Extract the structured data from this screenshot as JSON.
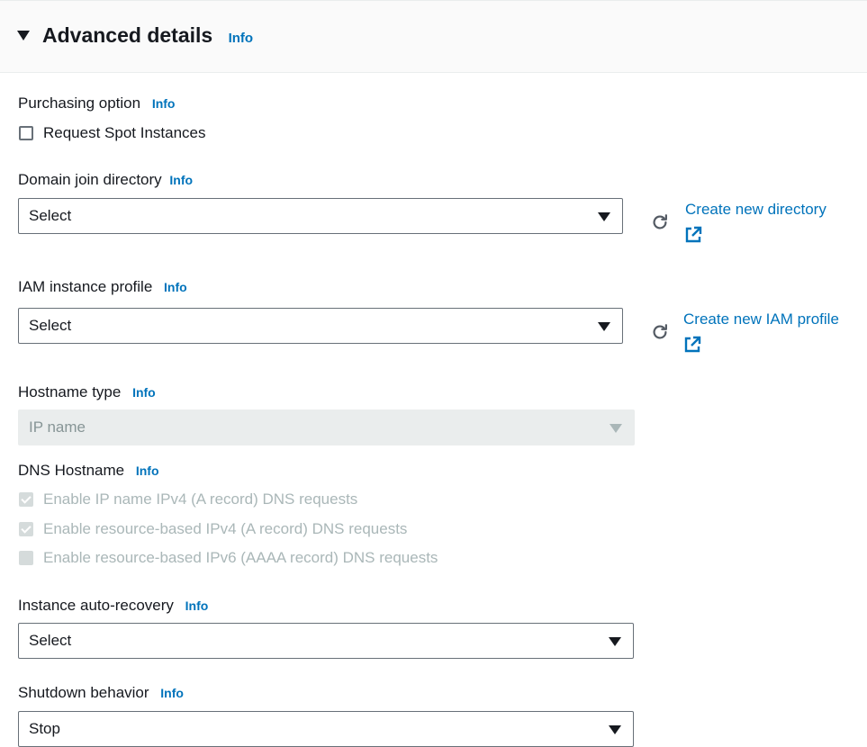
{
  "header": {
    "title": "Advanced details",
    "info": "Info"
  },
  "purchasing": {
    "label": "Purchasing option",
    "info": "Info",
    "checkbox_label": "Request Spot Instances"
  },
  "domain_join": {
    "label": "Domain join directory",
    "info": "Info",
    "value": "Select",
    "link": "Create new directory"
  },
  "iam_profile": {
    "label": "IAM instance profile",
    "info": "Info",
    "value": "Select",
    "link": "Create new IAM profile"
  },
  "hostname_type": {
    "label": "Hostname type",
    "info": "Info",
    "value": "IP name"
  },
  "dns_hostname": {
    "label": "DNS Hostname",
    "info": "Info",
    "options": [
      {
        "label": "Enable IP name IPv4 (A record) DNS requests",
        "checked": true
      },
      {
        "label": "Enable resource-based IPv4 (A record) DNS requests",
        "checked": true
      },
      {
        "label": "Enable resource-based IPv6 (AAAA record) DNS requests",
        "checked": false
      }
    ]
  },
  "auto_recovery": {
    "label": "Instance auto-recovery",
    "info": "Info",
    "value": "Select"
  },
  "shutdown": {
    "label": "Shutdown behavior",
    "info": "Info",
    "value": "Stop"
  },
  "colors": {
    "link": "#0073bb",
    "text": "#16191f",
    "disabled": "#aab7b8",
    "border": "#687078"
  }
}
